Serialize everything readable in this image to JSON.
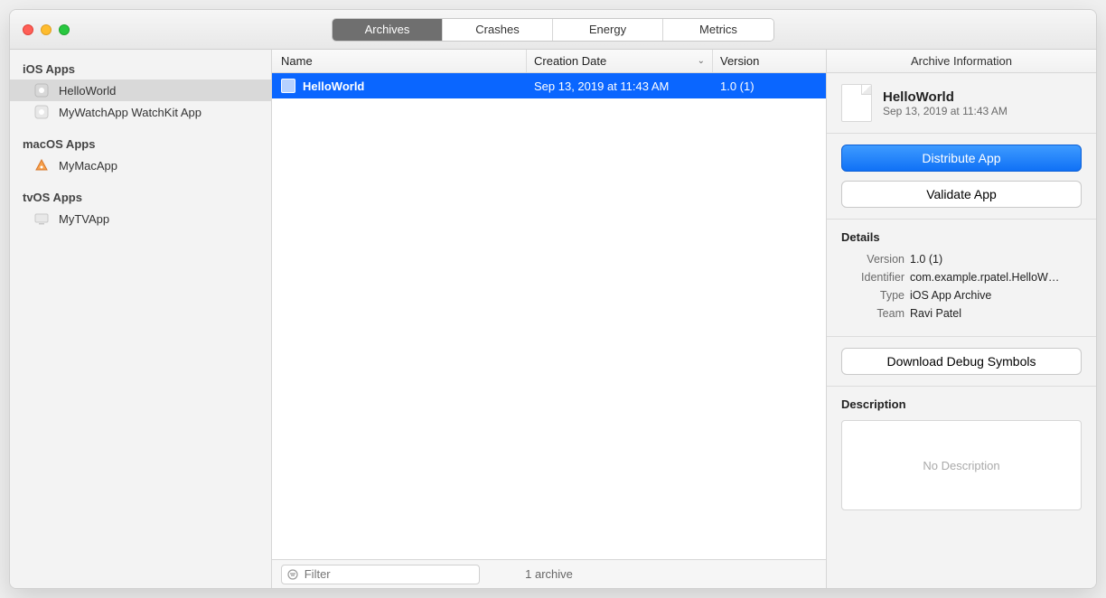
{
  "tabs": [
    {
      "label": "Archives",
      "active": true
    },
    {
      "label": "Crashes",
      "active": false
    },
    {
      "label": "Energy",
      "active": false
    },
    {
      "label": "Metrics",
      "active": false
    }
  ],
  "sidebar": {
    "groups": [
      {
        "title": "iOS Apps",
        "items": [
          {
            "label": "HelloWorld",
            "selected": true
          },
          {
            "label": "MyWatchApp WatchKit App",
            "selected": false
          }
        ]
      },
      {
        "title": "macOS Apps",
        "items": [
          {
            "label": "MyMacApp",
            "selected": false
          }
        ]
      },
      {
        "title": "tvOS Apps",
        "items": [
          {
            "label": "MyTVApp",
            "selected": false
          }
        ]
      }
    ]
  },
  "table": {
    "headers": {
      "name": "Name",
      "date": "Creation Date",
      "version": "Version"
    },
    "rows": [
      {
        "name": "HelloWorld",
        "date": "Sep 13, 2019 at 11:43 AM",
        "version": "1.0 (1)",
        "selected": true
      }
    ]
  },
  "footer": {
    "filter_placeholder": "Filter",
    "count": "1 archive"
  },
  "right": {
    "title": "Archive Information",
    "archive_name": "HelloWorld",
    "archive_date": "Sep 13, 2019 at 11:43 AM",
    "distribute_label": "Distribute App",
    "validate_label": "Validate App",
    "details_title": "Details",
    "details": {
      "version_k": "Version",
      "version_v": "1.0 (1)",
      "identifier_k": "Identifier",
      "identifier_v": "com.example.rpatel.HelloW…",
      "type_k": "Type",
      "type_v": "iOS App Archive",
      "team_k": "Team",
      "team_v": "Ravi Patel"
    },
    "download_label": "Download Debug Symbols",
    "description_title": "Description",
    "description_placeholder": "No Description"
  }
}
